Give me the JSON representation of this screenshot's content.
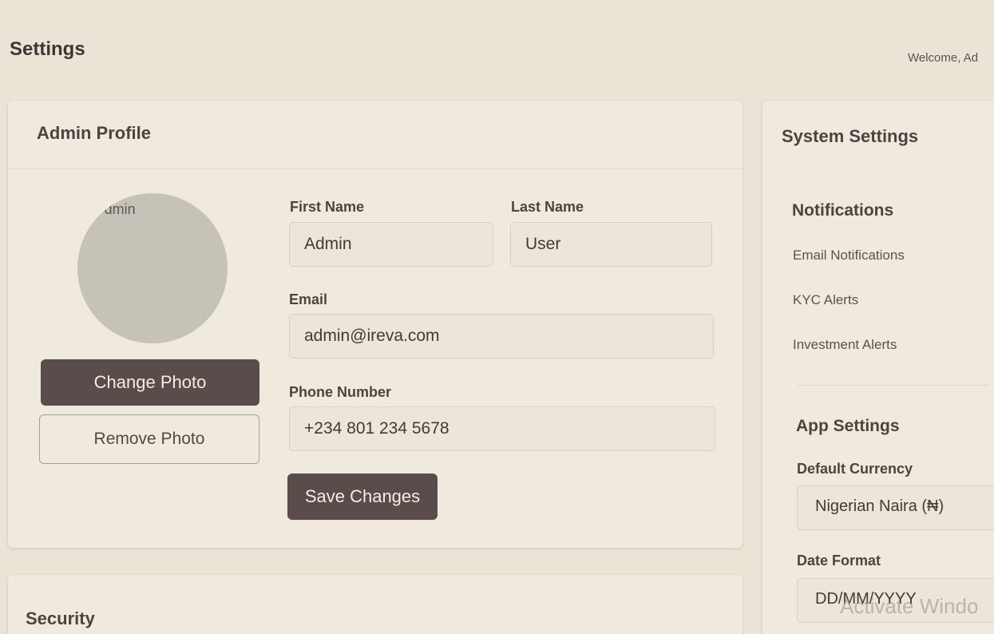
{
  "header": {
    "title": "Settings",
    "welcome": "Welcome, Ad"
  },
  "profile": {
    "title": "Admin Profile",
    "avatar_alt": " dmin",
    "change_photo_label": "Change Photo",
    "remove_photo_label": "Remove Photo",
    "first_name_label": "First Name",
    "first_name_value": "Admin",
    "last_name_label": "Last Name",
    "last_name_value": "User",
    "email_label": "Email",
    "email_value": "admin@ireva.com",
    "phone_label": "Phone Number",
    "phone_value": "+234 801 234 5678",
    "save_label": "Save Changes"
  },
  "security": {
    "title": "Security"
  },
  "system": {
    "title": "System Settings",
    "notifications": {
      "title": "Notifications",
      "items": [
        "Email Notifications",
        "KYC Alerts",
        "Investment Alerts"
      ]
    },
    "app_settings": {
      "title": "App Settings",
      "currency_label": "Default Currency",
      "currency_value": "Nigerian Naira (₦)",
      "date_format_label": "Date Format",
      "date_format_value": "DD/MM/YYYY"
    }
  },
  "watermark": "Activate Windo"
}
